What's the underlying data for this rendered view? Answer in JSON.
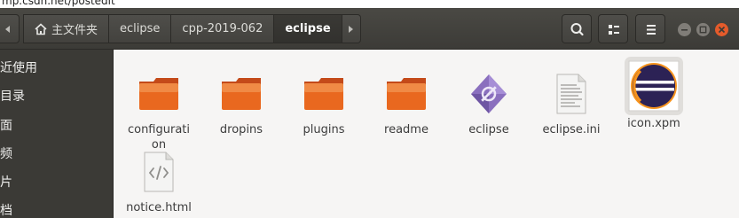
{
  "url_fragment": "mp.csdn.net/postedit",
  "header": {
    "breadcrumbs": [
      {
        "label": "主文件夹",
        "icon": "home-icon",
        "active": false
      },
      {
        "label": "eclipse",
        "active": false
      },
      {
        "label": "cpp-2019-062",
        "active": false
      },
      {
        "label": "eclipse",
        "active": true
      }
    ]
  },
  "sidebar": {
    "items": [
      {
        "label": "最近使用"
      },
      {
        "label": "主目录"
      },
      {
        "label": "桌面"
      },
      {
        "label": "视频"
      },
      {
        "label": "图片"
      },
      {
        "label": "文档"
      }
    ]
  },
  "files": [
    {
      "label": "configuration",
      "type": "folder-icon"
    },
    {
      "label": "dropins",
      "type": "folder-icon"
    },
    {
      "label": "plugins",
      "type": "folder-icon"
    },
    {
      "label": "readme",
      "type": "folder-icon"
    },
    {
      "label": "eclipse",
      "type": "executable-icon"
    },
    {
      "label": "eclipse.ini",
      "type": "text-file-icon"
    },
    {
      "label": "icon.xpm",
      "type": "eclipse-logo-icon"
    },
    {
      "label": "notice.html",
      "type": "html-file-icon"
    }
  ],
  "colors": {
    "headerbar": "#3c3b37",
    "sidebar": "#3b3a36",
    "folder_orange": "#e6581f",
    "close_button": "#e45b2b",
    "background": "#f6f5f4"
  }
}
